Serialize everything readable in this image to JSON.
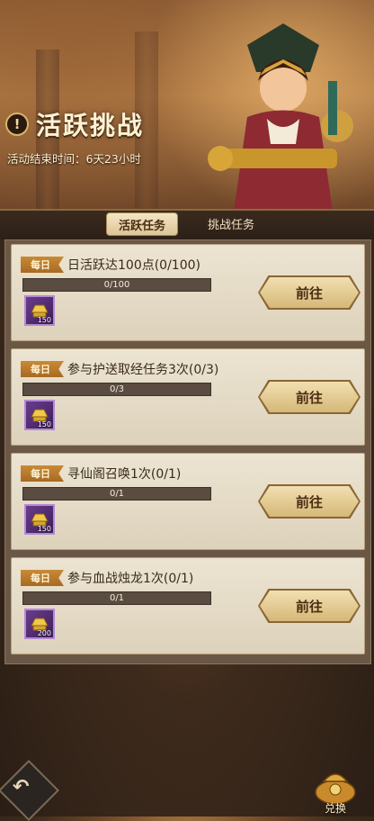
{
  "header": {
    "title": "活跃挑战",
    "end_time": "活动结束时间：6天23小时"
  },
  "tabs": [
    {
      "label": "活跃任务",
      "active": true
    },
    {
      "label": "挑战任务",
      "active": false
    }
  ],
  "tasks": [
    {
      "badge": "每日",
      "title": "日活跃达100点(0/100)",
      "progress_text": "0/100",
      "progress_fraction": 0,
      "reward_count": "150",
      "button": "前往"
    },
    {
      "badge": "每日",
      "title": "参与护送取经任务3次(0/3)",
      "progress_text": "0/3",
      "progress_fraction": 0,
      "reward_count": "150",
      "button": "前往"
    },
    {
      "badge": "每日",
      "title": "寻仙阁召唤1次(0/1)",
      "progress_text": "0/1",
      "progress_fraction": 0,
      "reward_count": "150",
      "button": "前往"
    },
    {
      "badge": "每日",
      "title": "参与血战烛龙1次(0/1)",
      "progress_text": "0/1",
      "progress_fraction": 0,
      "reward_count": "200",
      "button": "前往"
    }
  ],
  "footer": {
    "exchange_label": "兑换"
  },
  "icons": {
    "back": "back-arrow-icon",
    "exchange": "money-bag-icon",
    "reward": "gold-ingot-icon"
  },
  "colors": {
    "accent": "#c98a36",
    "button": "#e6cc93",
    "panel": "#6b5746"
  }
}
